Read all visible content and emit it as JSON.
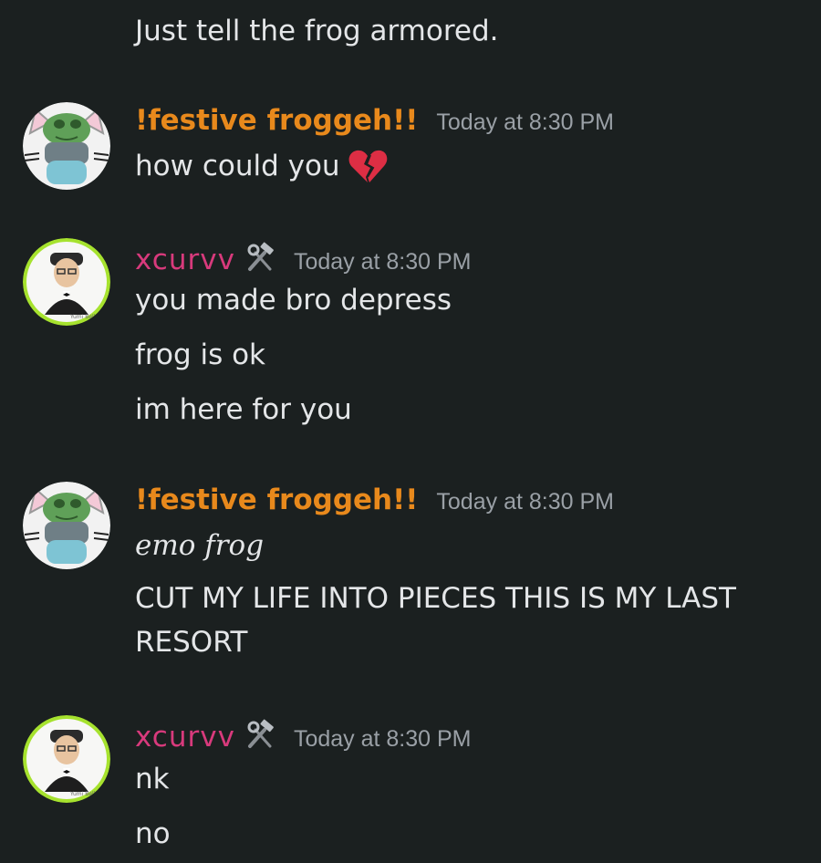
{
  "messages_top": {
    "continuation_text": "Just tell the frog armored."
  },
  "groups": [
    {
      "author": "!festive froggeh!!",
      "timestamp": "Today at 8:30 PM",
      "lines": [
        "how could you"
      ],
      "emoji": "broken-heart-icon"
    },
    {
      "author": "xcurvv",
      "role_icon": "hammer-wrench-icon",
      "timestamp": "Today at 8:30 PM",
      "lines": [
        "you made bro depress",
        "frog is ok",
        "im here for you"
      ]
    },
    {
      "author": "!festive froggeh!!",
      "timestamp": "Today at 8:30 PM",
      "lines": [
        "emo frog",
        "CUT MY LIFE INTO PIECES THIS IS MY LAST",
        "RESORT"
      ]
    },
    {
      "author": "xcurvv",
      "role_icon": "hammer-wrench-icon",
      "timestamp": "Today at 8:30 PM",
      "lines": [
        "nk",
        "no"
      ]
    }
  ],
  "avatar_labels": {
    "xcurvv_badge": "Yumi Bell"
  },
  "colors": {
    "background": "#1b2020",
    "frog_name": "#e8891c",
    "xcurvv_name": "#d83a7c",
    "text": "#e4e6e8",
    "timestamp": "#9aa0a6",
    "xcurvv_avatar_ring": "#a6e22e"
  }
}
